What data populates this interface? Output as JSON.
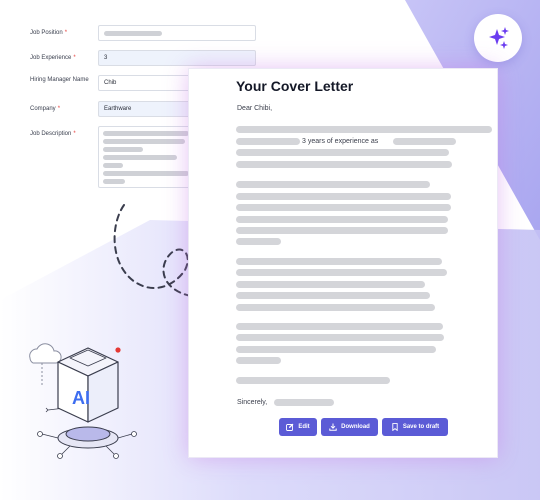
{
  "form": {
    "fields": [
      {
        "label": "Job Position",
        "required": true,
        "value": ""
      },
      {
        "label": "Job Experience",
        "required": true,
        "value": "3"
      },
      {
        "label": "Hiring Manager Name",
        "required": false,
        "value": "Chib"
      },
      {
        "label": "Company",
        "required": true,
        "value": "Earthware"
      },
      {
        "label": "Job Description",
        "required": true,
        "value": ""
      }
    ]
  },
  "letter": {
    "title": "Your Cover Letter",
    "greeting": "Dear Chibi,",
    "experience_phrase": "3 years of experience as",
    "closing": "Sincerely,"
  },
  "actions": {
    "edit_label": "Edit",
    "download_label": "Download",
    "save_label": "Save to draft"
  },
  "illustration": {
    "badge_text": "AI"
  },
  "colors": {
    "accent": "#5b5bd6",
    "badge_star": "#6b3df0",
    "required_mark": "#e53935",
    "background_shape": "#c9c7f5"
  },
  "icons": [
    "sparkles-icon",
    "edit-icon",
    "download-icon",
    "bookmark-icon",
    "cloud-icon",
    "ai-cube-icon"
  ]
}
